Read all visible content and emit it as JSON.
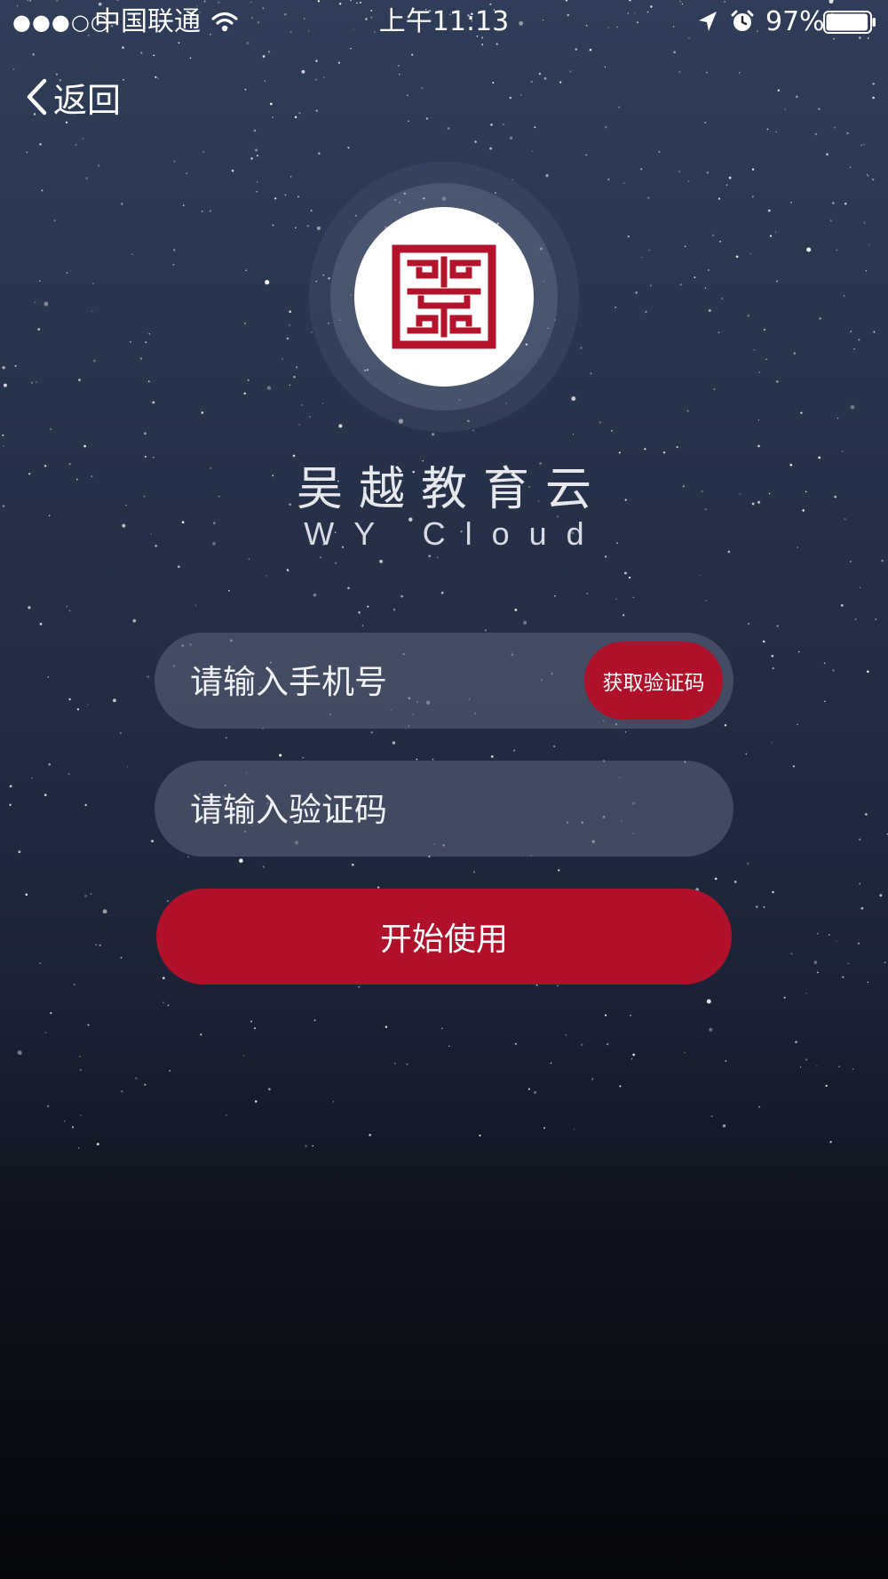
{
  "status_bar": {
    "signal": "●●●○○",
    "carrier": "中国联通",
    "time": "上午11:13",
    "battery": "97%",
    "battery_level": 0.97
  },
  "nav": {
    "back_label": "返回"
  },
  "brand": {
    "title": "吴越教育云",
    "subtitle": "WY Cloud"
  },
  "form": {
    "phone_placeholder": "请输入手机号",
    "get_code_label": "获取验证码",
    "code_placeholder": "请输入验证码",
    "submit_label": "开始使用"
  },
  "colors": {
    "accent": "#b1102a",
    "field_bg": "#5f667d"
  }
}
